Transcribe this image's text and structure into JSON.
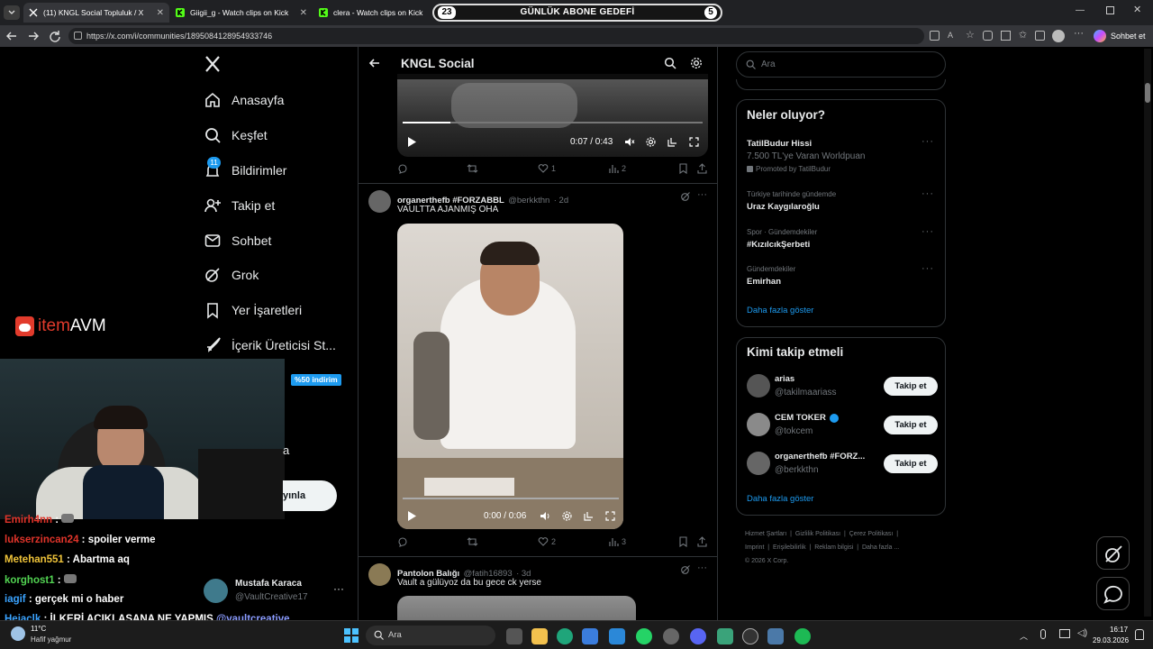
{
  "browser": {
    "tabs": [
      {
        "label": "(11) KNGL Social Topluluk / X",
        "active": true
      },
      {
        "label": "Giigii_g - Watch clips on Kick",
        "active": false
      },
      {
        "label": "clera - Watch clips on Kick",
        "active": false
      }
    ],
    "goal": {
      "left": "23",
      "label": "GÜNLÜK ABONE GEDEFİ",
      "right": "5"
    },
    "url": "https://x.com/i/communities/1895084128954933746",
    "chat_button": "Sohbet et"
  },
  "nav": {
    "items": [
      {
        "label": "Anasayfa",
        "icon": "home-icon"
      },
      {
        "label": "Keşfet",
        "icon": "search-icon"
      },
      {
        "label": "Bildirimler",
        "icon": "bell-icon",
        "badge": "11"
      },
      {
        "label": "Takip et",
        "icon": "add-user-icon"
      },
      {
        "label": "Sohbet",
        "icon": "mail-icon"
      },
      {
        "label": "Grok",
        "icon": "grok-icon"
      },
      {
        "label": "Yer İşaretleri",
        "icon": "bookmark-icon"
      },
      {
        "label": "İçerik Üreticisi St...",
        "icon": "rocket-icon"
      }
    ],
    "profile": {
      "name": "Mustafa Karaca",
      "handle": "@VaultCreative17"
    },
    "post_button_fragment": "yınla",
    "fragment_a": "a"
  },
  "overlay": {
    "brand_a": "item",
    "brand_b": "AVM",
    "discount": "%50 indirim"
  },
  "chat": [
    {
      "user": "Emirh4nn",
      "color": "#e0342a",
      "message": ""
    },
    {
      "user": "lukserzincan24",
      "color": "#e0342a",
      "message": "spoiler verme"
    },
    {
      "user": "Metehan551",
      "color": "#f0c43a",
      "message": "Abartma aq"
    },
    {
      "user": "korghost1",
      "color": "#52d352",
      "message": ""
    },
    {
      "user": "iagif",
      "color": "#3aa3ff",
      "message": "gerçek mi o haber"
    },
    {
      "user": "Hejaclk",
      "color": "#3aa3ff",
      "message": "İLKERİ AÇIKLASANA NE YAPMIŞ",
      "mention": "@vaultcreative"
    }
  ],
  "header": {
    "title": "KNGL Social"
  },
  "post1": {
    "time": "0:07 / 0:43",
    "likes": "1",
    "views": "2",
    "progress": 0.16
  },
  "post2": {
    "name": "organerthefb #FORZABBL",
    "handle": "@berkkthn",
    "age": "· 2d",
    "text": "VAULTTA AJANMIŞ OHA",
    "time": "0:00 / 0:06",
    "likes": "2",
    "views": "3",
    "progress": 0.0
  },
  "post3": {
    "name": "Pantolon Balığı",
    "handle": "@fatih16893",
    "age": "· 3d",
    "text": "Vault a gülüyoz da bu gece ck yerse"
  },
  "search": {
    "placeholder": "Ara"
  },
  "trends": {
    "title": "Neler oluyor?",
    "items": [
      {
        "top": "TatilBudur Hissi",
        "sub": "7.500 TL'ye Varan Worldpuan",
        "promo": "Promoted by TatilBudur"
      },
      {
        "context": "Türkiye tarihinde gündemde",
        "name": "Uraz Kaygılaroğlu"
      },
      {
        "context": "Spor · Gündemdekiler",
        "name": "#KızılcıkŞerbeti"
      },
      {
        "context": "Gündemdekiler",
        "name": "Emirhan"
      }
    ],
    "more": "Daha fazla göster"
  },
  "who_to_follow": {
    "title": "Kimi takip etmeli",
    "users": [
      {
        "name": "arias",
        "handle": "@takilmaariass"
      },
      {
        "name": "CEM TOKER",
        "handle": "@tokcem"
      },
      {
        "name": "organerthefb #FORZ...",
        "handle": "@berkkthn"
      }
    ],
    "follow_label": "Takip et",
    "more": "Daha fazla göster"
  },
  "footer": {
    "links": [
      "Hizmet Şartları",
      "Gizlilik Politikası",
      "Çerez Politikası",
      "Imprint",
      "Erişilebilirlik",
      "Reklam bilgisi",
      "Daha fazla ..."
    ],
    "copyright": "© 2026 X Corp."
  },
  "taskbar": {
    "weather_temp": "11°C",
    "weather_text": "Hafif yağmur",
    "search_placeholder": "Ara",
    "time": "16:17",
    "date": "29.03.2026"
  },
  "colors": {
    "accent": "#1d9bf0",
    "background": "#000000",
    "border": "#2f3336"
  }
}
